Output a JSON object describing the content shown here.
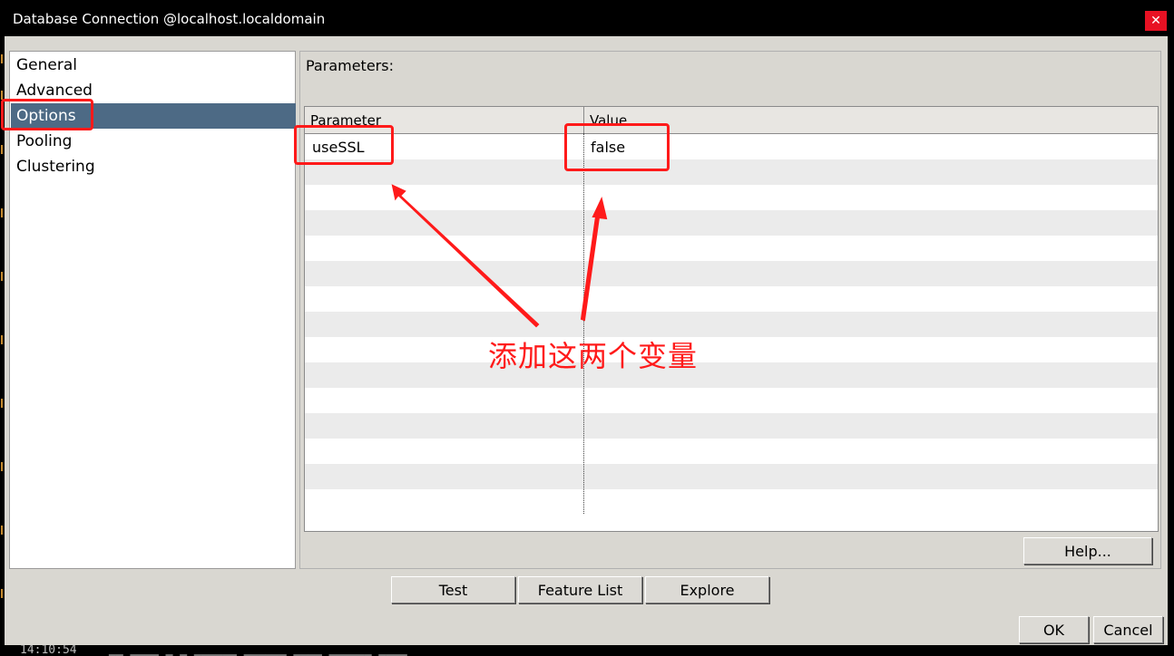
{
  "window": {
    "title": "Database Connection @localhost.localdomain",
    "close_label": "✕",
    "close_icon": "close-icon"
  },
  "sidebar": {
    "items": [
      {
        "label": "General",
        "selected": false
      },
      {
        "label": "Advanced",
        "selected": false
      },
      {
        "label": "Options",
        "selected": true
      },
      {
        "label": "Pooling",
        "selected": false
      },
      {
        "label": "Clustering",
        "selected": false
      }
    ],
    "selected_color": "#4d6a85"
  },
  "parameters": {
    "label": "Parameters:",
    "columns": [
      "Parameter",
      "Value"
    ],
    "rows": [
      {
        "parameter": "useSSL",
        "value": "false"
      }
    ]
  },
  "buttons": {
    "help": "Help...",
    "test": "Test",
    "feature_list": "Feature List",
    "explore": "Explore",
    "ok": "OK",
    "cancel": "Cancel"
  },
  "annotation": {
    "text": "添加这两个变量",
    "color": "#ff1a1a"
  },
  "background": {
    "timestamp": "14:10:54"
  }
}
